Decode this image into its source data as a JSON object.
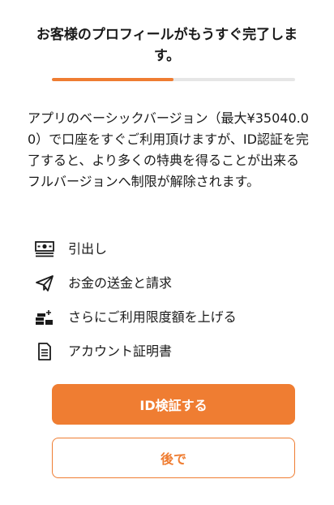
{
  "header": {
    "title": "お客様のプロフィールがもうすぐ完了します。"
  },
  "progress": {
    "fraction": 0.5
  },
  "description": "アプリのベーシックバージョン（最大¥35040.00）で口座をすぐご利用頂けますが、ID認証を完了すると、より多くの特典を得ることが出来るフルバージョンへ制限が解除されます。",
  "features": [
    {
      "icon": "cash-icon",
      "label": "引出し"
    },
    {
      "icon": "paper-plane-icon",
      "label": "お金の送金と請求"
    },
    {
      "icon": "stacked-coins-icon",
      "label": "さらにご利用限度額を上げる"
    },
    {
      "icon": "document-icon",
      "label": "アカウント証明書"
    }
  ],
  "buttons": {
    "verify_label": "ID検証する",
    "later_label": "後で"
  },
  "colors": {
    "accent": "#ef7d32",
    "progress_track": "#e6e6e6",
    "text": "#1a1a1a"
  }
}
